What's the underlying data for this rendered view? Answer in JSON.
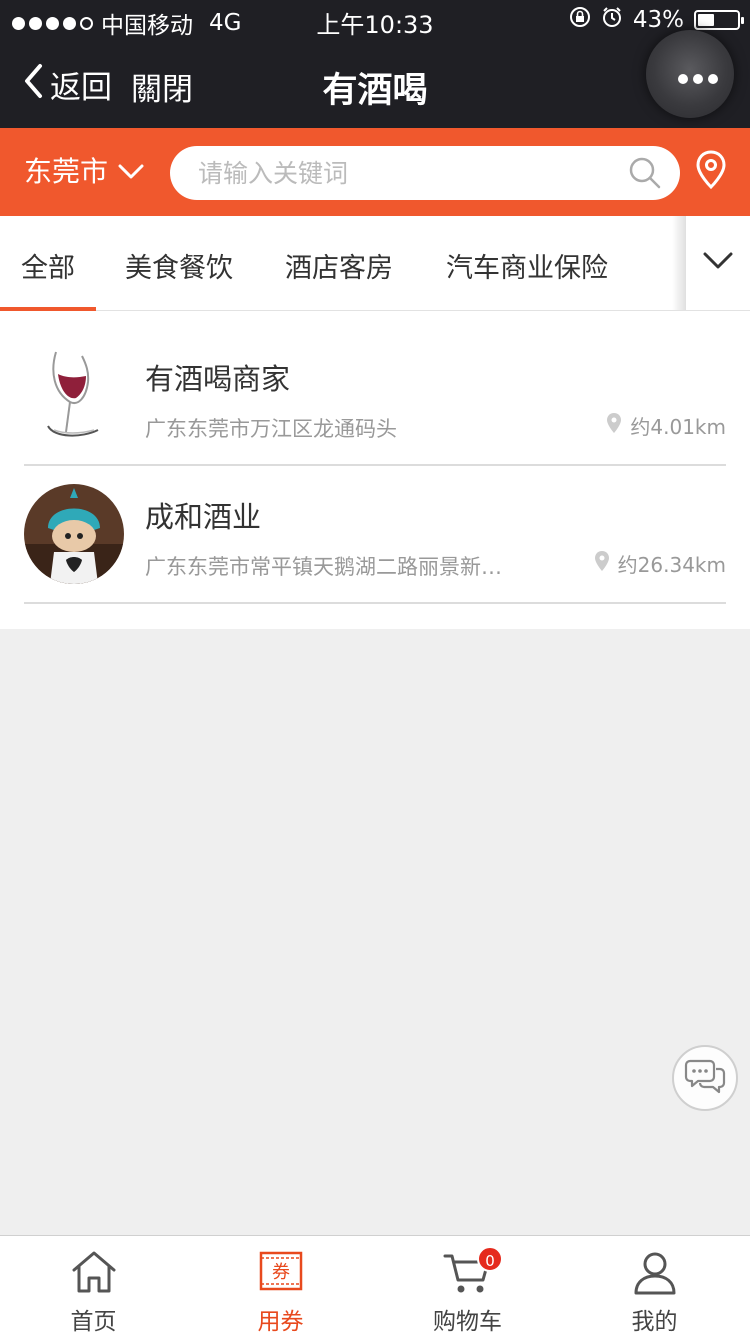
{
  "status_bar": {
    "carrier": "中国移动",
    "network": "4G",
    "time": "上午10:33",
    "battery": "43%",
    "battery_level": 0.43
  },
  "nav": {
    "back_label": "返回",
    "close_label": "關閉",
    "title": "有酒喝"
  },
  "search": {
    "city": "东莞市",
    "placeholder": "请输入关键词"
  },
  "tabs": [
    {
      "label": "全部"
    },
    {
      "label": "美食餐饮"
    },
    {
      "label": "酒店客房"
    },
    {
      "label": "汽车商业保险"
    }
  ],
  "merchants": [
    {
      "name": "有酒喝商家",
      "address": "广东东莞市万江区龙通码头",
      "distance": "约4.01km"
    },
    {
      "name": "成和酒业",
      "address": "广东东莞市常平镇天鹅湖二路丽景新…",
      "distance": "约26.34km"
    }
  ],
  "tabbar": {
    "items": [
      {
        "label": "首页",
        "icon": "home-icon"
      },
      {
        "label": "用券",
        "icon": "coupon-icon",
        "icon_text": "券"
      },
      {
        "label": "购物车",
        "icon": "cart-icon",
        "badge": "0"
      },
      {
        "label": "我的",
        "icon": "user-icon"
      }
    ]
  },
  "colors": {
    "accent": "#f0582d",
    "active_tab": "#e8491d",
    "dark_bar": "#1f1f24",
    "badge": "#e52a1d"
  }
}
